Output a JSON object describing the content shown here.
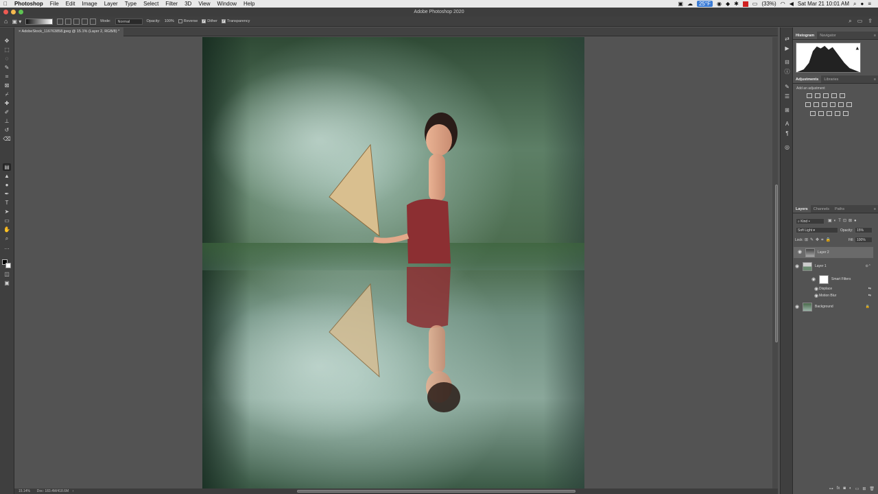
{
  "menubar": {
    "apple": "",
    "app": "Photoshop",
    "items": [
      "File",
      "Edit",
      "Image",
      "Layer",
      "Type",
      "Select",
      "Filter",
      "3D",
      "View",
      "Window",
      "Help"
    ],
    "temp": "25°F",
    "battery": "(33%)",
    "clock": "Sat Mar 21  10:01 AM"
  },
  "window": {
    "title": "Adobe Photoshop 2020"
  },
  "options": {
    "mode_label": "Mode:",
    "mode_value": "Normal",
    "opacity_label": "Opacity:",
    "opacity_value": "100%",
    "reverse": "Reverse",
    "dither": "Dither",
    "transparency": "Transparency"
  },
  "document": {
    "tab": "AdobeStock_116763858.jpeg @ 15.1% (Layer 2, RGB/8) *",
    "zoom": "15.14%",
    "doc_info": "Doc: 183.4M/418.6M"
  },
  "panels": {
    "top_tabs": [
      "Histogram",
      "Navigator"
    ],
    "adj_tabs": [
      "Adjustments",
      "Libraries"
    ],
    "add_adjustment": "Add an adjustment",
    "layer_tabs": [
      "Layers",
      "Channels",
      "Paths"
    ],
    "kind": "Kind",
    "blend_mode": "Soft Light",
    "opacity_label": "Opacity:",
    "opacity_value": "15%",
    "lock_label": "Lock:",
    "fill_label": "Fill:",
    "fill_value": "100%",
    "layers": [
      {
        "name": "Layer 2"
      },
      {
        "name": "Layer 1"
      },
      {
        "name": "Smart Filters"
      },
      {
        "name": "Displace"
      },
      {
        "name": "Motion Blur"
      },
      {
        "name": "Background"
      }
    ]
  },
  "colors": {
    "accent": "#3a7bd5",
    "panel": "#535353",
    "chrome": "#3f3f3f"
  }
}
